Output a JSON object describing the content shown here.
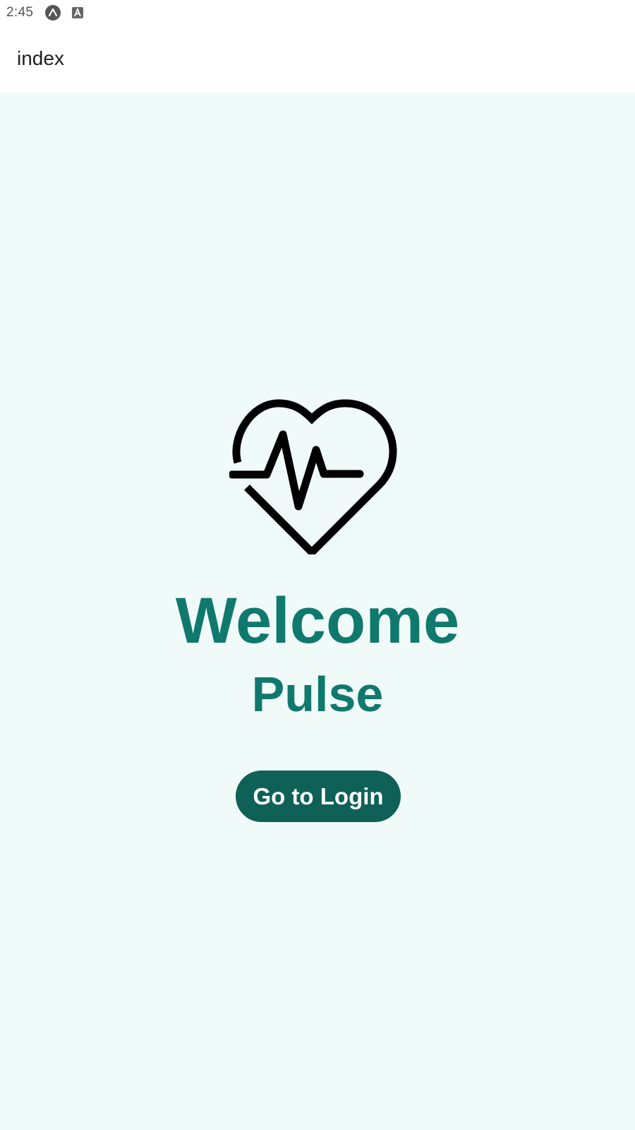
{
  "status_bar": {
    "time": "2:45",
    "icons": [
      "expo-icon",
      "accessibility-a-icon"
    ]
  },
  "app_bar": {
    "title": "index"
  },
  "main": {
    "logo_icon": "heart-pulse-icon",
    "welcome": "Welcome",
    "app_name": "Pulse",
    "login_button_label": "Go to Login"
  },
  "colors": {
    "background": "#f0fbf9",
    "title_teal": "#10796e",
    "button_teal": "#0f6157",
    "button_text": "#ffffff"
  }
}
